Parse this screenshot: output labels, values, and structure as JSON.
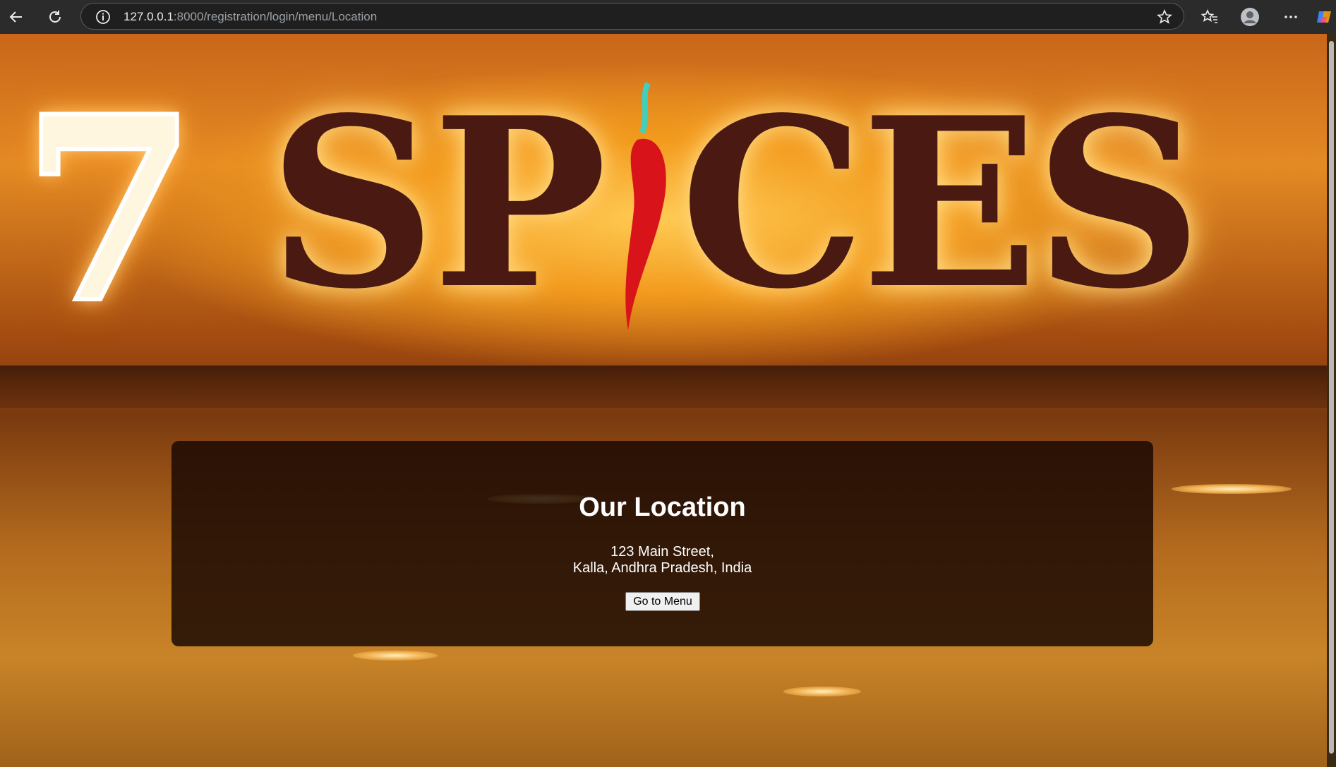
{
  "browser": {
    "url_host": "127.0.0.1",
    "url_path": ":8000/registration/login/menu/Location"
  },
  "sign": {
    "number": "7",
    "word": "SP CES"
  },
  "location": {
    "title": "Our Location",
    "street": "123 Main Street,",
    "city_line": "Kalla, Andhra Pradesh, India",
    "button_label": "Go to Menu"
  },
  "colors": {
    "card_bg": "#190802",
    "sign_text": "#4a1a12",
    "chrome_bg": "#2b2b2b"
  }
}
